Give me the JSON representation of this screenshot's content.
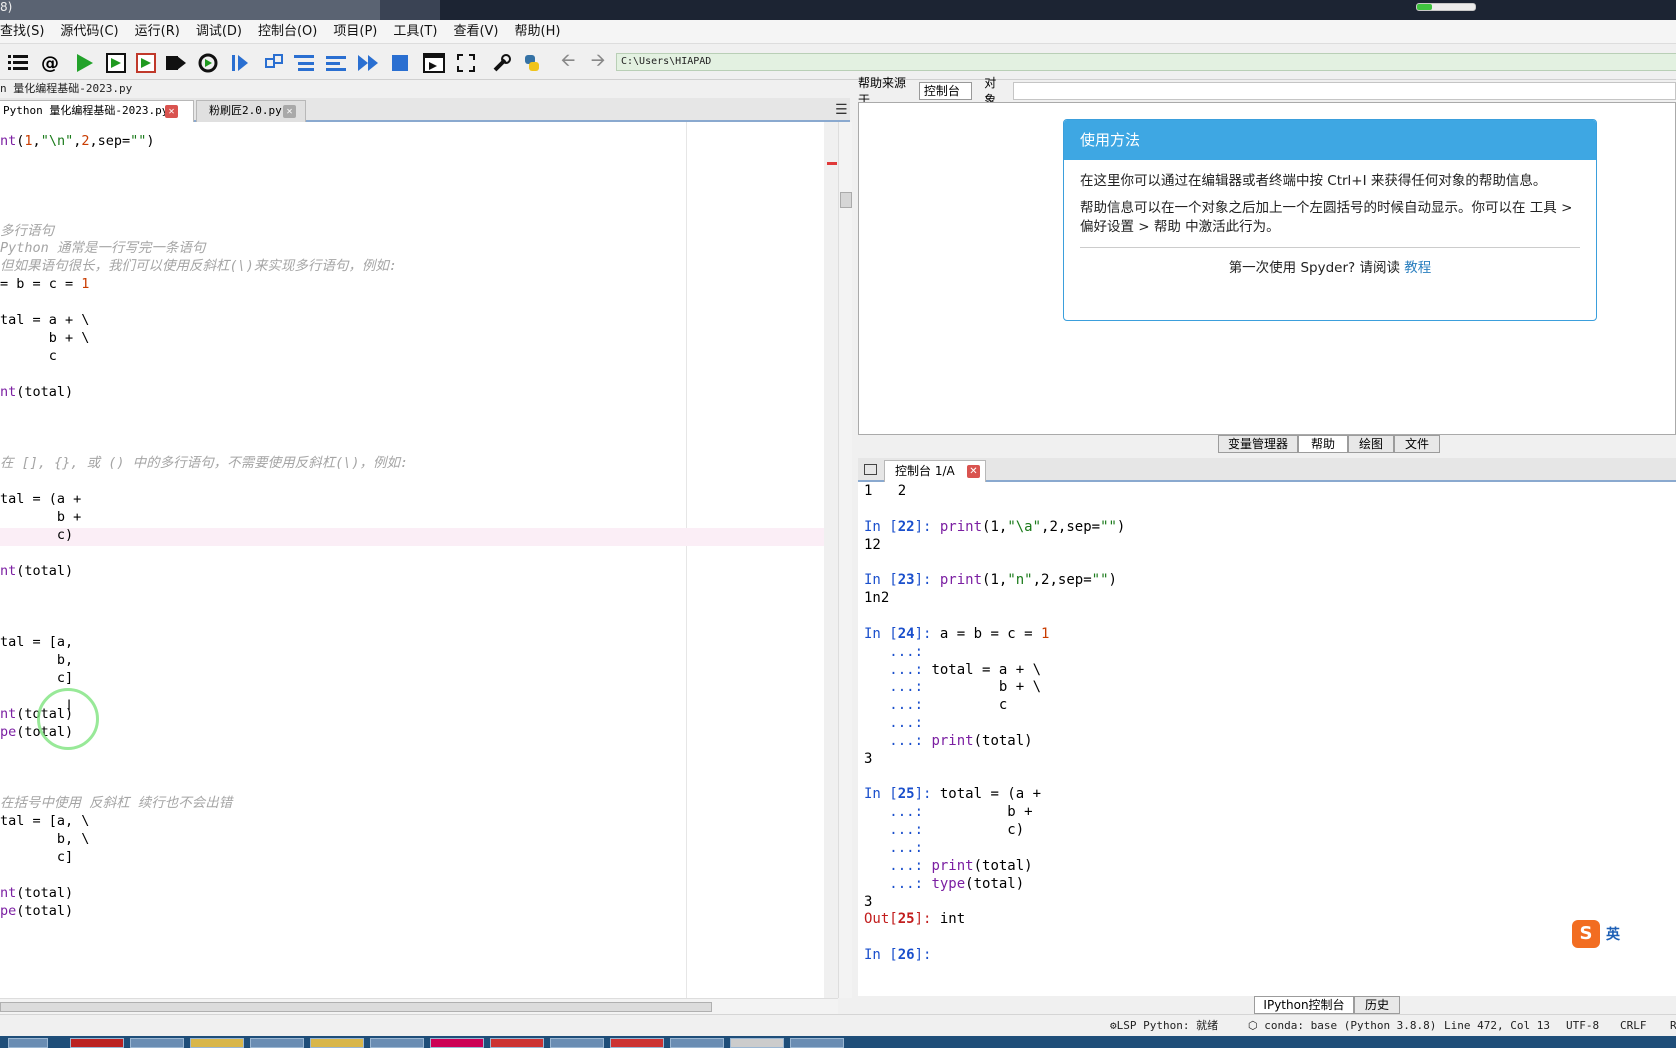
{
  "window": {
    "title_fragment": "8)"
  },
  "menubar": [
    "查找(S)",
    "源代码(C)",
    "运行(R)",
    "调试(D)",
    "控制台(O)",
    "项目(P)",
    "工具(T)",
    "查看(V)",
    "帮助(H)"
  ],
  "toolbar": {
    "path": "C:\\Users\\HIAPAD",
    "icons": [
      "list-icon",
      "at-icon",
      "run-icon",
      "run-cell-icon",
      "run-cell-advance-icon",
      "run-selection-icon",
      "rerun-icon",
      "debug-icon",
      "step-icon",
      "step-into-icon",
      "step-return-icon",
      "continue-icon",
      "stop-icon",
      "maximize-pane-icon",
      "fullscreen-icon",
      "preferences-wrench-icon",
      "python-path-icon",
      "back-arrow-icon",
      "forward-arrow-icon"
    ]
  },
  "editor": {
    "breadcrumb": "n 量化编程基础-2023.py",
    "tabs": [
      {
        "label": "Python 量化编程基础-2023.py",
        "active": true
      },
      {
        "label": "粉刷匠2.0.py",
        "active": false
      }
    ],
    "lines": [
      {
        "t": "nt(1,\"\\n\",2,sep=\"\")",
        "k": "code"
      },
      {
        "t": "",
        "k": "code"
      },
      {
        "t": "",
        "k": "code"
      },
      {
        "t": "",
        "k": "code"
      },
      {
        "t": "",
        "k": "code"
      },
      {
        "t": "多行语句",
        "k": "comment"
      },
      {
        "t": "Python 通常是一行写完一条语句",
        "k": "comment"
      },
      {
        "t": "但如果语句很长，我们可以使用反斜杠(\\)来实现多行语句，例如:",
        "k": "comment"
      },
      {
        "t": "= b = c = 1",
        "k": "code"
      },
      {
        "t": "",
        "k": "code"
      },
      {
        "t": "tal = a + \\",
        "k": "code"
      },
      {
        "t": "      b + \\",
        "k": "code"
      },
      {
        "t": "      c",
        "k": "code"
      },
      {
        "t": "",
        "k": "code"
      },
      {
        "t": "nt(total)",
        "k": "code"
      },
      {
        "t": "",
        "k": "code"
      },
      {
        "t": "",
        "k": "code"
      },
      {
        "t": "",
        "k": "code"
      },
      {
        "t": "在 [], {}, 或 () 中的多行语句，不需要使用反斜杠(\\)，例如:",
        "k": "comment"
      },
      {
        "t": "",
        "k": "code"
      },
      {
        "t": "tal = (a +",
        "k": "code"
      },
      {
        "t": "       b +",
        "k": "code"
      },
      {
        "t": "       c)",
        "k": "code"
      },
      {
        "t": "",
        "k": "code"
      },
      {
        "t": "nt(total)",
        "k": "code"
      },
      {
        "t": "",
        "k": "code"
      },
      {
        "t": "",
        "k": "code"
      },
      {
        "t": "",
        "k": "code"
      },
      {
        "t": "tal = [a,",
        "k": "code"
      },
      {
        "t": "       b,",
        "k": "code"
      },
      {
        "t": "       c]",
        "k": "code"
      },
      {
        "t": "",
        "k": "code"
      },
      {
        "t": "nt(total)",
        "k": "code"
      },
      {
        "t": "pe(total)",
        "k": "code"
      },
      {
        "t": "",
        "k": "code"
      },
      {
        "t": "",
        "k": "code"
      },
      {
        "t": "",
        "k": "code"
      },
      {
        "t": "在括号中使用 反斜杠 续行也不会出错",
        "k": "comment"
      },
      {
        "t": "tal = [a, \\",
        "k": "code"
      },
      {
        "t": "       b, \\",
        "k": "code"
      },
      {
        "t": "       c]",
        "k": "code"
      },
      {
        "t": "",
        "k": "code"
      },
      {
        "t": "nt(total)",
        "k": "code"
      },
      {
        "t": "pe(total)",
        "k": "code"
      }
    ]
  },
  "help": {
    "source_label": "帮助来源于",
    "source_value": "控制台",
    "object_label": "对象",
    "card_title": "使用方法",
    "para1": "在这里你可以通过在编辑器或者终端中按 Ctrl+I 来获得任何对象的帮助信息。",
    "para2": "帮助信息可以在一个对象之后加上一个左圆括号的时候自动显示。你可以在 工具 > 偏好设置 > 帮助 中激活此行为。",
    "footer_text": "第一次使用 Spyder? 请阅读",
    "footer_link": "教程",
    "tabs": [
      "变量管理器",
      "帮助",
      "绘图",
      "文件"
    ],
    "active_tab": "帮助"
  },
  "console": {
    "tab_label": "控制台 1/A",
    "lines": [
      {
        "parts": [
          [
            "1   2",
            ""
          ]
        ]
      },
      {
        "parts": []
      },
      {
        "parts": [
          [
            "In [",
            "in"
          ],
          [
            "22",
            "inb"
          ],
          [
            "]: ",
            "in"
          ],
          [
            "print",
            "kw"
          ],
          [
            "(1,",
            ""
          ],
          [
            "\"\\a\"",
            "str"
          ],
          [
            ",2,sep=",
            ""
          ],
          [
            "\"\"",
            "str"
          ],
          [
            ")",
            ""
          ]
        ]
      },
      {
        "parts": [
          [
            "12",
            ""
          ]
        ]
      },
      {
        "parts": []
      },
      {
        "parts": [
          [
            "In [",
            "in"
          ],
          [
            "23",
            "inb"
          ],
          [
            "]: ",
            "in"
          ],
          [
            "print",
            "kw"
          ],
          [
            "(1,",
            ""
          ],
          [
            "\"n\"",
            "str"
          ],
          [
            ",2,sep=",
            ""
          ],
          [
            "\"\"",
            "str"
          ],
          [
            ")",
            ""
          ]
        ]
      },
      {
        "parts": [
          [
            "1n2",
            ""
          ]
        ]
      },
      {
        "parts": []
      },
      {
        "parts": [
          [
            "In [",
            "in"
          ],
          [
            "24",
            "inb"
          ],
          [
            "]: ",
            "in"
          ],
          [
            "a = b = c = ",
            ""
          ],
          [
            "1",
            "num"
          ]
        ]
      },
      {
        "parts": [
          [
            "   ...: ",
            "in"
          ]
        ]
      },
      {
        "parts": [
          [
            "   ...: ",
            "in"
          ],
          [
            "total = a + \\",
            ""
          ]
        ]
      },
      {
        "parts": [
          [
            "   ...: ",
            "in"
          ],
          [
            "        b + \\",
            ""
          ]
        ]
      },
      {
        "parts": [
          [
            "   ...: ",
            "in"
          ],
          [
            "        c",
            ""
          ]
        ]
      },
      {
        "parts": [
          [
            "   ...: ",
            "in"
          ]
        ]
      },
      {
        "parts": [
          [
            "   ...: ",
            "in"
          ],
          [
            "print",
            "kw"
          ],
          [
            "(total)",
            ""
          ]
        ]
      },
      {
        "parts": [
          [
            "3",
            ""
          ]
        ]
      },
      {
        "parts": []
      },
      {
        "parts": [
          [
            "In [",
            "in"
          ],
          [
            "25",
            "inb"
          ],
          [
            "]: ",
            "in"
          ],
          [
            "total = (a +",
            ""
          ]
        ]
      },
      {
        "parts": [
          [
            "   ...: ",
            "in"
          ],
          [
            "         b +",
            ""
          ]
        ]
      },
      {
        "parts": [
          [
            "   ...: ",
            "in"
          ],
          [
            "         c)",
            ""
          ]
        ]
      },
      {
        "parts": [
          [
            "   ...: ",
            "in"
          ]
        ]
      },
      {
        "parts": [
          [
            "   ...: ",
            "in"
          ],
          [
            "print",
            "kw"
          ],
          [
            "(total)",
            ""
          ]
        ]
      },
      {
        "parts": [
          [
            "   ...: ",
            "in"
          ],
          [
            "type",
            "kw"
          ],
          [
            "(total)",
            ""
          ]
        ]
      },
      {
        "parts": [
          [
            "3",
            ""
          ]
        ]
      },
      {
        "parts": [
          [
            "Out[",
            "out"
          ],
          [
            "25",
            "outb"
          ],
          [
            "]: ",
            "out"
          ],
          [
            "int",
            ""
          ]
        ]
      },
      {
        "parts": []
      },
      {
        "parts": [
          [
            "In [",
            "in"
          ],
          [
            "26",
            "inb"
          ],
          [
            "]: ",
            "in"
          ]
        ]
      }
    ],
    "bottom_tabs": [
      "IPython控制台",
      "历史"
    ],
    "ime_label": "英"
  },
  "statusbar": {
    "lsp": "LSP Python: 就绪",
    "conda": "conda: base (Python 3.8.8)",
    "position": "Line 472, Col 13",
    "encoding": "UTF-8",
    "eol": "CRLF",
    "extra": "R"
  },
  "progress_fraction": 0.25
}
